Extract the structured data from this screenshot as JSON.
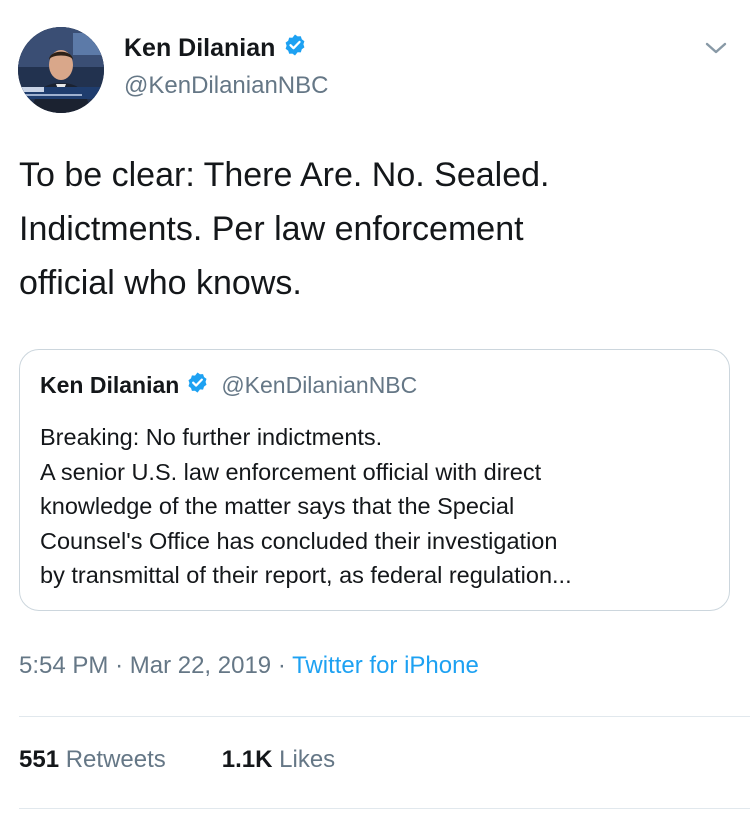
{
  "tweet": {
    "author_name": "Ken Dilanian",
    "author_handle": "@KenDilanianNBC",
    "text": "To be clear: There Are. No. Sealed. Indictments. Per law enforcement official who knows.",
    "text_lines": [
      "To be clear: There Are. No. Sealed.",
      "Indictments. Per law enforcement",
      "official who knows."
    ],
    "time": "5:54 PM",
    "date": "Mar 22, 2019",
    "source": "Twitter for iPhone",
    "separator": "·",
    "retweets_count": "551",
    "retweets_label": "Retweets",
    "likes_count": "1.1K",
    "likes_label": "Likes"
  },
  "quoted_tweet": {
    "author_name": "Ken Dilanian",
    "author_handle": "@KenDilanianNBC",
    "lines": [
      "Breaking: No further indictments.",
      "A senior U.S. law enforcement official with direct",
      "knowledge of the matter says that the Special",
      "Counsel's Office has concluded their investigation",
      "by transmittal of their report, as federal regulation..."
    ]
  },
  "icons": {
    "verified": "verified-badge-icon",
    "menu": "chevron-down-icon"
  },
  "colors": {
    "accent": "#1da1f2",
    "text_primary": "#14171a",
    "text_secondary": "#657786",
    "border": "#ccd6dd"
  }
}
